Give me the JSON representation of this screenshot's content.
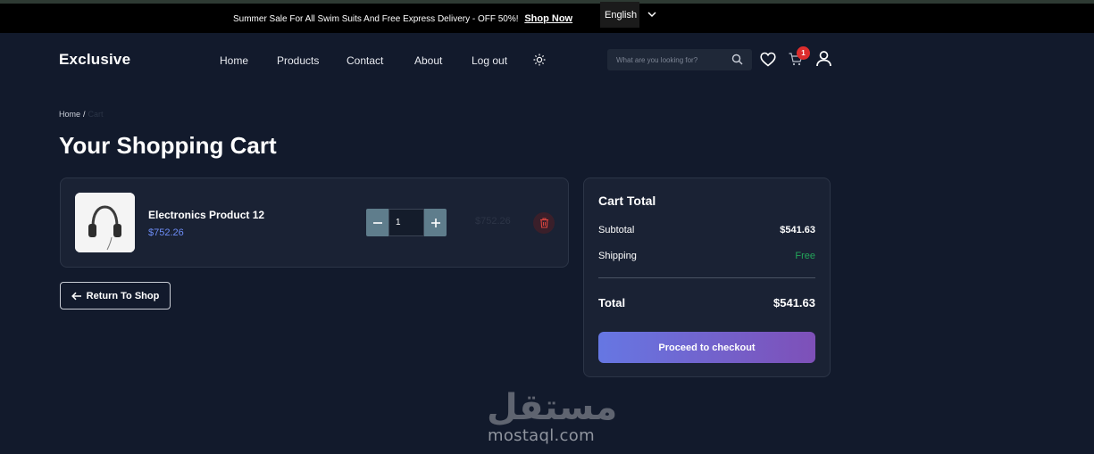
{
  "topbar": {
    "promo_text": "Summer Sale For All Swim Suits And Free Express Delivery - OFF 50%!",
    "promo_link": "Shop Now",
    "language": "English"
  },
  "header": {
    "logo": "Exclusive",
    "nav": [
      "Home",
      "Products",
      "Contact",
      "About",
      "Log out"
    ],
    "search_placeholder": "What are you looking for?",
    "cart_count": "1"
  },
  "breadcrumb": {
    "home": "Home",
    "separator": "/",
    "current": "Cart"
  },
  "page_title": "Your Shopping Cart",
  "cart_items": [
    {
      "name": "Electronics Product 12",
      "price": "$752.26",
      "quantity": "1",
      "line_total": "$752.26"
    }
  ],
  "return_button": "Return To Shop",
  "summary": {
    "title": "Cart Total",
    "subtotal_label": "Subtotal",
    "subtotal_value": "$541.63",
    "shipping_label": "Shipping",
    "shipping_value": "Free",
    "total_label": "Total",
    "total_value": "$541.63",
    "checkout_button": "Proceed to checkout"
  },
  "watermark": {
    "arabic": "مستقل",
    "latin": "mostaql.com"
  },
  "colors": {
    "background": "#121a2c",
    "card": "#1a2234",
    "accent_price": "#6d8cf5",
    "free": "#23a55a",
    "badge": "#dd2d2d",
    "checkout_gradient_start": "#6677e3",
    "checkout_gradient_end": "#7e50b8"
  },
  "icons": [
    "chevron-down-icon",
    "sun-icon",
    "search-icon",
    "heart-icon",
    "cart-icon",
    "user-icon",
    "headphones-image",
    "minus-icon",
    "plus-icon",
    "trash-icon",
    "arrow-left-icon"
  ]
}
